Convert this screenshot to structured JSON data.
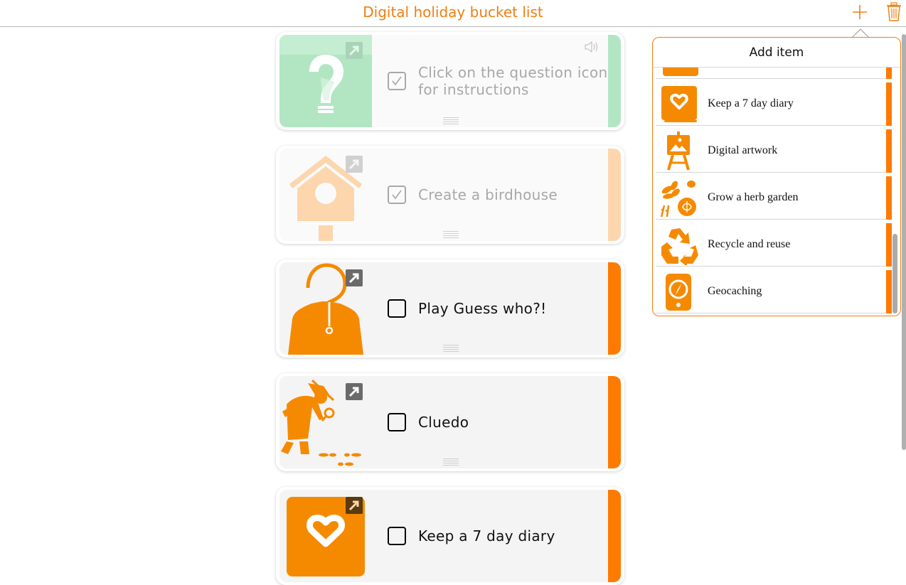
{
  "header": {
    "title": "Digital holiday bucket list",
    "add_icon": "plus-icon",
    "delete_icon": "trash-icon"
  },
  "colors": {
    "accent": "#f07e10",
    "stripe_orange": "#ff7a00",
    "icon_orange": "#f58a00",
    "instructions_green": "#b2e6c3",
    "faded_orange": "#fdd6ad"
  },
  "list": {
    "cards": [
      {
        "label": "Click on the question icon for instructions",
        "checked": true,
        "faded": true,
        "icon": "question-bulb-icon",
        "has_audio": true,
        "audio_icon": "speaker-icon"
      },
      {
        "label": "Create a birdhouse",
        "checked": true,
        "faded": true,
        "icon": "birdhouse-icon"
      },
      {
        "label": "Play Guess who?!",
        "checked": false,
        "faded": false,
        "icon": "guess-who-icon"
      },
      {
        "label": "Cluedo",
        "checked": false,
        "faded": false,
        "icon": "detective-icon"
      },
      {
        "label": "Keep a 7 day diary",
        "checked": false,
        "faded": false,
        "icon": "diary-icon"
      }
    ]
  },
  "add_item_popover": {
    "title": "Add item",
    "items": [
      {
        "label": "",
        "icon": "partial-item-icon"
      },
      {
        "label": "Keep a 7 day diary",
        "icon": "diary-icon"
      },
      {
        "label": "Digital artwork",
        "icon": "easel-icon"
      },
      {
        "label": "Grow a herb garden",
        "icon": "herbs-icon"
      },
      {
        "label": "Recycle and reuse",
        "icon": "recycle-icon"
      },
      {
        "label": "Geocaching",
        "icon": "phone-compass-icon"
      }
    ]
  }
}
